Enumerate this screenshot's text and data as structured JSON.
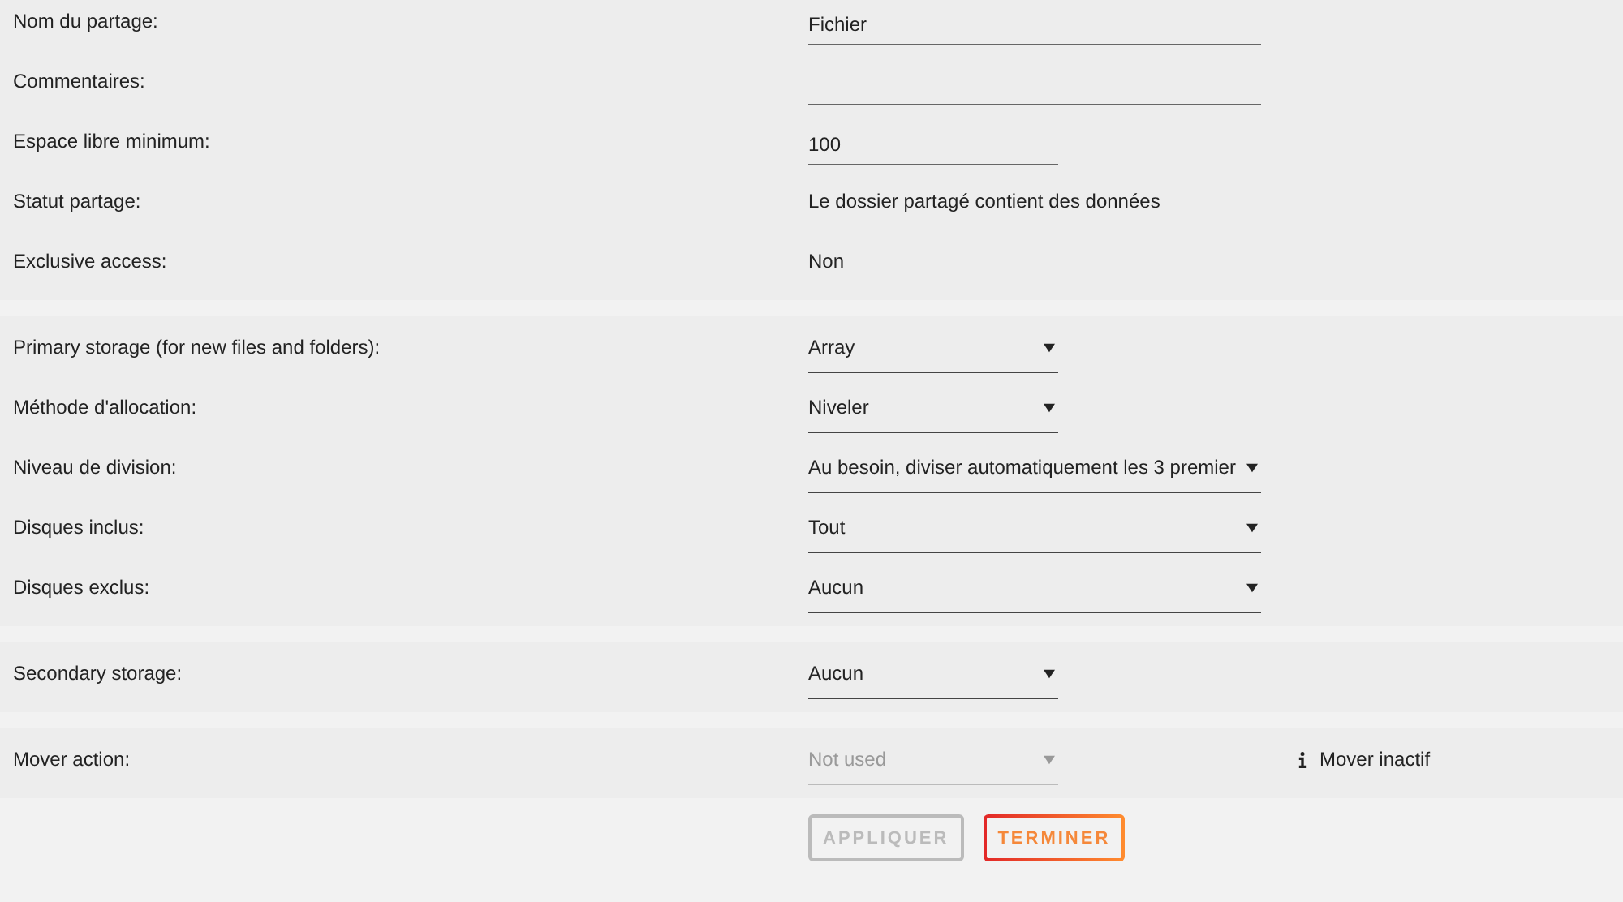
{
  "sections": [
    {
      "rows": [
        {
          "label": "Nom du partage:",
          "kind": "input",
          "wide": true,
          "value": "Fichier"
        },
        {
          "label": "Commentaires:",
          "kind": "input",
          "wide": true
        },
        {
          "label": "Espace libre minimum:",
          "kind": "input",
          "wide": false,
          "value": "100"
        },
        {
          "label": "Statut partage:",
          "kind": "text",
          "value": "Le dossier partagé contient des données"
        },
        {
          "label": "Exclusive access:",
          "kind": "text",
          "value": "Non"
        }
      ]
    },
    {
      "rows": [
        {
          "label": "Primary storage (for new files and folders):",
          "kind": "select",
          "wide": false,
          "disabled": false,
          "value": "Array"
        },
        {
          "label": "Méthode d'allocation:",
          "kind": "select",
          "wide": false,
          "disabled": false,
          "value": "Niveler"
        },
        {
          "label": "Niveau de division:",
          "kind": "select",
          "wide": true,
          "disabled": false,
          "value": "Au besoin, diviser automatiquement les 3 premier"
        },
        {
          "label": "Disques inclus:",
          "kind": "select",
          "wide": true,
          "disabled": false,
          "value": "Tout"
        },
        {
          "label": "Disques exclus:",
          "kind": "select",
          "wide": true,
          "disabled": false,
          "value": "Aucun"
        }
      ]
    },
    {
      "rows": [
        {
          "label": "Secondary storage:",
          "kind": "select",
          "wide": false,
          "disabled": false,
          "value": "Aucun"
        }
      ]
    },
    {
      "rows": [
        {
          "label": "Mover action:",
          "kind": "select",
          "wide": false,
          "disabled": true,
          "value": "Not used",
          "note": "Mover inactif"
        }
      ]
    }
  ],
  "buttons": [
    {
      "label": "APPLIQUER",
      "disabled": true
    },
    {
      "label": "TERMINER",
      "disabled": false
    }
  ]
}
